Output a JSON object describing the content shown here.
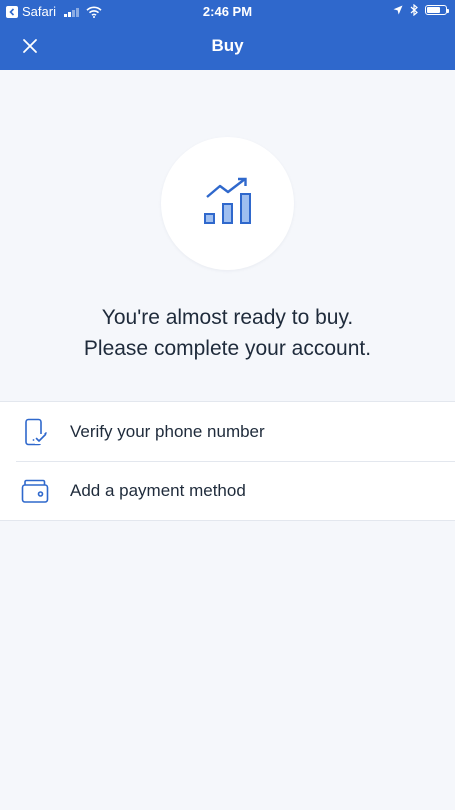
{
  "status_bar": {
    "carrier": "Safari",
    "time": "2:46 PM",
    "battery_level": 0.7
  },
  "nav": {
    "title": "Buy",
    "close_icon": "close-icon"
  },
  "hero": {
    "icon": "chart-trend-icon"
  },
  "message": {
    "line1": "You're almost ready to buy.",
    "line2": "Please complete your account."
  },
  "tasks": [
    {
      "label": "Verify your phone number",
      "icon": "phone-verify-icon"
    },
    {
      "label": "Add a payment method",
      "icon": "wallet-icon"
    }
  ],
  "colors": {
    "header": "#2f68cc",
    "accent": "#2f68cc",
    "background": "#f5f7fb"
  }
}
